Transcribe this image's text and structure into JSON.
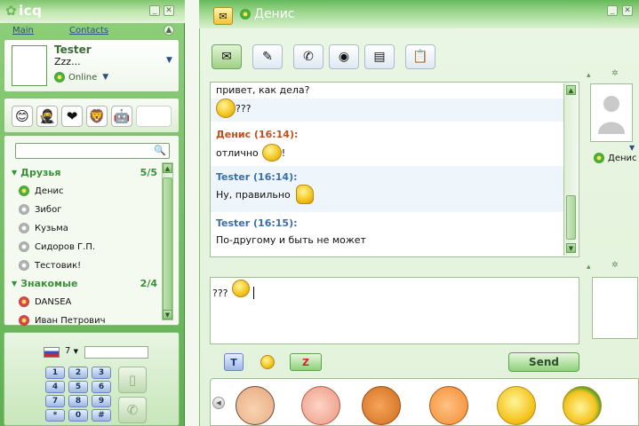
{
  "app": {
    "logo": "icq"
  },
  "left": {
    "tabs": {
      "main": "Main",
      "contacts": "Contacts"
    },
    "profile": {
      "name": "Tester",
      "status_message": "Zzz...",
      "status": "Online"
    },
    "xtraz_icons": [
      "face-icon",
      "ninja-icon",
      "heart-icon",
      "lion-icon",
      "robot-icon"
    ],
    "groups": [
      {
        "name": "Друзья",
        "count": "5/5",
        "contacts": [
          {
            "name": "Денис",
            "status": "online"
          },
          {
            "name": "Зибог",
            "status": "offline"
          },
          {
            "name": "Кузьма",
            "status": "offline"
          },
          {
            "name": "Сидоров Г.П.",
            "status": "offline"
          },
          {
            "name": "Тестовик!",
            "status": "offline"
          }
        ]
      },
      {
        "name": "Знакомые",
        "count": "2/4",
        "contacts": [
          {
            "name": "DANSEA",
            "status": "away"
          },
          {
            "name": "Иван Петрович",
            "status": "away"
          }
        ]
      }
    ],
    "dialer": {
      "country_code": "7",
      "keys": [
        "1",
        "2",
        "3",
        "4",
        "5",
        "6",
        "7",
        "8",
        "9",
        "*",
        "0",
        "#"
      ]
    }
  },
  "chat": {
    "title": "Денис",
    "messages": [
      {
        "header": "",
        "text": "привет, как дела?",
        "emoticon": ""
      },
      {
        "header": "",
        "text": "???",
        "emoticon": "smile"
      },
      {
        "header": "Денис (16:14):",
        "author": "remote",
        "text": "отлично",
        "emoticon_after": "!"
      },
      {
        "header": "Tester (16:14):",
        "author": "self",
        "text": "Ну, правильно",
        "emoticon": "thumb"
      },
      {
        "header": "Tester (16:15):",
        "author": "self",
        "text": "По-другому и быть не может"
      }
    ],
    "input_text": "???",
    "send_label": "Send",
    "remote_name": "Денис",
    "colors": {
      "remote": "#c0501a",
      "self": "#3a6ea8"
    }
  }
}
